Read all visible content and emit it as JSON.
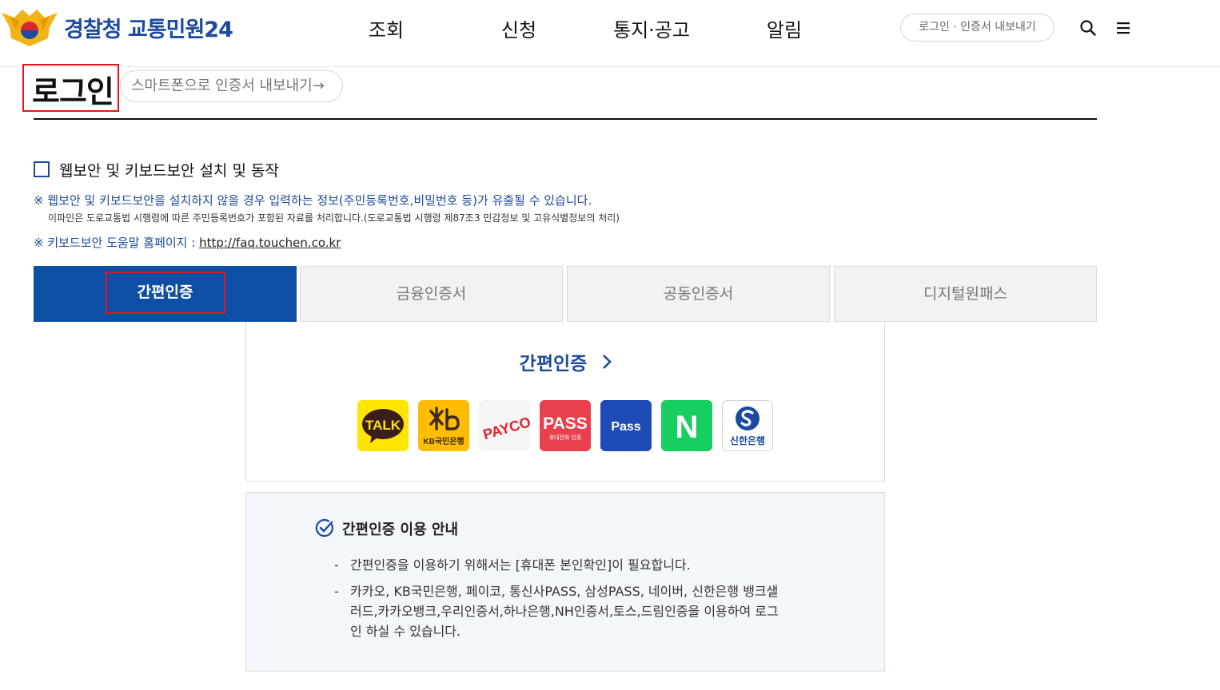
{
  "header": {
    "logo_text": "경찰청 교통민원24",
    "nav": [
      "조회",
      "신청",
      "통지·공고",
      "알림"
    ],
    "login_button": "로그인 · 인증서 내보내기",
    "search_icon": "search-icon",
    "menu_icon": "hamburger-menu-icon"
  },
  "page": {
    "title": "로그인",
    "smartphone_export": "스마트폰으로 인증서 내보내기→"
  },
  "security": {
    "checkbox_label": "웹보안 및 키보드보안 설치 및 동작",
    "checked": false,
    "notice_primary": "※ 웹보안 및 키보드보안을 설치하지 않을 경우 입력하는 정보(주민등록번호,비밀번호 등)가 유출될 수 있습니다.",
    "notice_secondary": "이파인은 도로교통법 시행령에 따른 주민등록번호가 포함된 자료를 처리합니다.(도로교통법 시행령 제87조3 민감정보 및 고유식별정보의 처리)",
    "help_prefix": "※ 키보드보안 도움말 홈페이지 : ",
    "help_link": "http://faq.touchen.co.kr"
  },
  "tabs": [
    {
      "label": "간편인증",
      "active": true
    },
    {
      "label": "금융인증서",
      "active": false
    },
    {
      "label": "공동인증서",
      "active": false
    },
    {
      "label": "디지털원패스",
      "active": false
    }
  ],
  "easy_auth": {
    "heading": "간편인증",
    "chevron": "›",
    "providers": [
      {
        "name": "kakao-talk",
        "label": "TALK",
        "bg": "#FEE500"
      },
      {
        "name": "kb-bank",
        "label": "KB국민은행",
        "bg": "#FFBC00"
      },
      {
        "name": "payco",
        "label": "PAYCO",
        "bg": "#F5F5F5"
      },
      {
        "name": "pass",
        "label": "PASS",
        "sub": "휴대전화 인증",
        "bg": "#E8404C"
      },
      {
        "name": "samsung-pass",
        "label": "Pass",
        "bg": "#1F4BB8"
      },
      {
        "name": "naver",
        "label": "N",
        "bg": "#19CE60"
      },
      {
        "name": "shinhan",
        "label": "신한은행",
        "bg": "#FFFFFF"
      }
    ]
  },
  "guide": {
    "title": "간편인증 이용 안내",
    "items": [
      "간편인증을 이용하기 위해서는 [휴대폰 본인확인]이 필요합니다.",
      "카카오, KB국민은행, 페이코, 통신사PASS, 삼성PASS, 네이버, 신한은행 뱅크샐러드,카카오뱅크,우리인증서,하나은행,NH인증서,토스,드림인증을 이용하여 로그인 하실 수 있습니다."
    ]
  }
}
